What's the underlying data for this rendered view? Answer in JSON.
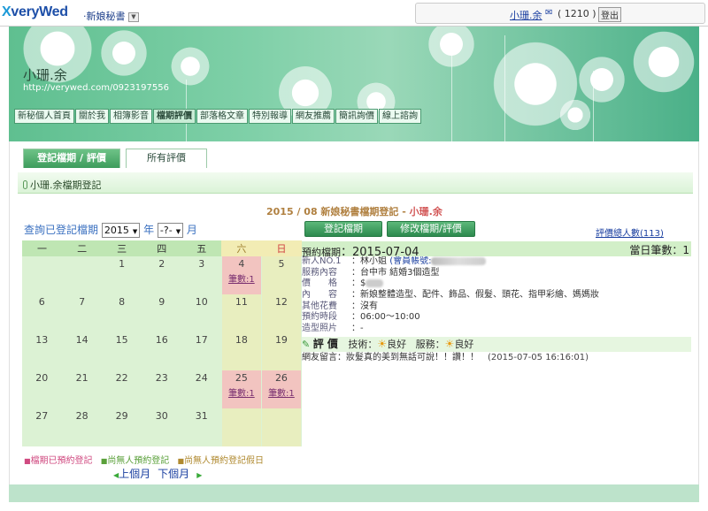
{
  "header": {
    "logo_x": "X",
    "logo_text": "veryWed",
    "section": "‧新娘秘書",
    "dropdown_glyph": "▼",
    "user_name": "小珊.余",
    "mail_icon": "✉",
    "message_count": "( 1210 )",
    "logout": "登出"
  },
  "profile": {
    "name": "小珊.余",
    "url": "http://verywed.com/0923197556"
  },
  "nav": [
    "新秘個人首頁",
    "關於我",
    "相簿影音",
    "檔期評價",
    "部落格文章",
    "特別報導",
    "網友推薦",
    "簡訊詢價",
    "線上諮詢"
  ],
  "tabs": [
    "登記檔期 / 評價",
    "所有評價"
  ],
  "section_title": "小珊.余檔期登記",
  "form_title": "2015 / 08 新娘秘書檔期登記 - ",
  "form_title_name": "小珊.余",
  "query": {
    "label": "查詢已登記檔期",
    "year": "2015",
    "year_unit": "年",
    "month": "-?-",
    "month_unit": "月"
  },
  "calendar": {
    "weekdays": [
      "一",
      "二",
      "三",
      "四",
      "五",
      "六",
      "日"
    ],
    "weeks": [
      [
        {
          "d": ""
        },
        {
          "d": ""
        },
        {
          "d": "1"
        },
        {
          "d": "2"
        },
        {
          "d": "3"
        },
        {
          "d": "4",
          "b": "筆數:1"
        },
        {
          "d": "5"
        }
      ],
      [
        {
          "d": "6"
        },
        {
          "d": "7"
        },
        {
          "d": "8"
        },
        {
          "d": "9"
        },
        {
          "d": "10"
        },
        {
          "d": "11"
        },
        {
          "d": "12"
        }
      ],
      [
        {
          "d": "13"
        },
        {
          "d": "14"
        },
        {
          "d": "15"
        },
        {
          "d": "16"
        },
        {
          "d": "17"
        },
        {
          "d": "18"
        },
        {
          "d": "19"
        }
      ],
      [
        {
          "d": "20"
        },
        {
          "d": "21"
        },
        {
          "d": "22"
        },
        {
          "d": "23"
        },
        {
          "d": "24"
        },
        {
          "d": "25",
          "b": "筆數:1"
        },
        {
          "d": "26",
          "b": "筆數:1"
        }
      ],
      [
        {
          "d": "27"
        },
        {
          "d": "28"
        },
        {
          "d": "29"
        },
        {
          "d": "30"
        },
        {
          "d": "31"
        },
        {
          "d": ""
        },
        {
          "d": ""
        }
      ]
    ]
  },
  "legend": {
    "booked": "檔期已預約登記",
    "free": "尚無人預約登記",
    "free_holiday": "尚無人預約登記假日"
  },
  "pager": {
    "prev": "上個月",
    "next": "下個月"
  },
  "buttons": {
    "register": "登記檔期",
    "edit": "修改檔期/評價"
  },
  "review_count": "評價總人數(113)",
  "detail": {
    "date_label": "預約檔期",
    "date": "2015-07-04",
    "count_label": "當日筆數：",
    "count": "1",
    "rows": [
      {
        "k": "新人NO.1",
        "v": "林小姐",
        "acc": "(會員帳號:"
      },
      {
        "k": "服務內容",
        "v": "台中市 結婚3個造型"
      },
      {
        "k": "價　　格",
        "v": "$"
      },
      {
        "k": "內　　容",
        "v": "新娘整體造型、配件、飾品、假髮、頭花、指甲彩繪、媽媽妝"
      },
      {
        "k": "其他花費",
        "v": "沒有"
      },
      {
        "k": "預約時段",
        "v": "06:00～10:00"
      },
      {
        "k": "造型照片",
        "v": "-"
      }
    ],
    "eval_label": "評 價",
    "tech_label": "技術：",
    "tech_value": "良好",
    "service_label": "服務：",
    "service_value": "良好",
    "comment_label": "網友留言：",
    "comment": "妝髮真的美到無話可說！！讚！！",
    "comment_date": "(2015-07-05 16:16:01)"
  }
}
